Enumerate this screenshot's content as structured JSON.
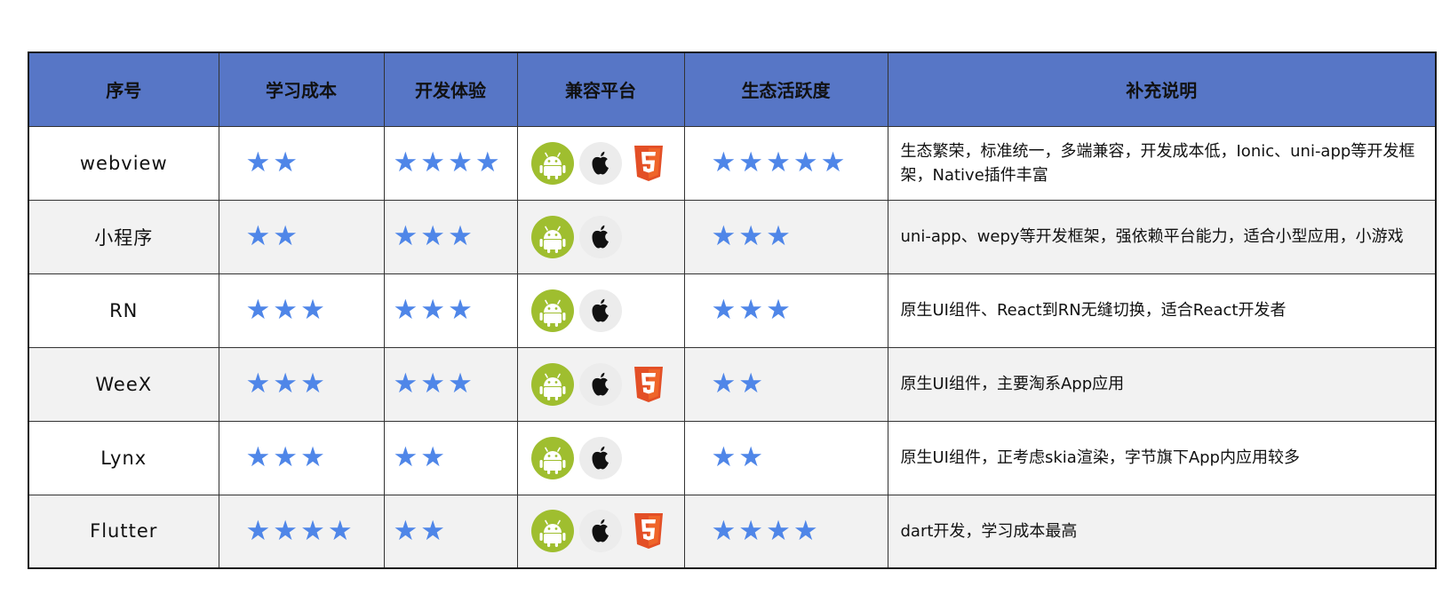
{
  "headers": [
    "序号",
    "学习成本",
    "开发体验",
    "兼容平台",
    "生态活跃度",
    "补充说明"
  ],
  "star_glyph": "★",
  "colors": {
    "header_bg": "#5776c6",
    "star": "#4f86e8",
    "android": "#9fbe2f",
    "html5": "#e34f26"
  },
  "rows": [
    {
      "name": "webview",
      "learning_cost": 2,
      "dev_experience": 4,
      "platforms": [
        "android-icon",
        "apple-icon",
        "html5-icon"
      ],
      "ecosystem": 5,
      "note": "生态繁荣，标准统一，多端兼容，开发成本低，Ionic、uni-app等开发框架，Native插件丰富"
    },
    {
      "name": "小程序",
      "learning_cost": 2,
      "dev_experience": 3,
      "platforms": [
        "android-icon",
        "apple-icon"
      ],
      "ecosystem": 3,
      "note": "uni-app、wepy等开发框架，强依赖平台能力，适合小型应用，小游戏"
    },
    {
      "name": "RN",
      "learning_cost": 3,
      "dev_experience": 3,
      "platforms": [
        "android-icon",
        "apple-icon"
      ],
      "ecosystem": 3,
      "note": "原生UI组件、React到RN无缝切换，适合React开发者"
    },
    {
      "name": "WeeX",
      "learning_cost": 3,
      "dev_experience": 3,
      "platforms": [
        "android-icon",
        "apple-icon",
        "html5-icon"
      ],
      "ecosystem": 2,
      "note": "原生UI组件，主要淘系App应用"
    },
    {
      "name": "Lynx",
      "learning_cost": 3,
      "dev_experience": 2,
      "platforms": [
        "android-icon",
        "apple-icon"
      ],
      "ecosystem": 2,
      "note": "原生UI组件，正考虑skia渲染，字节旗下App内应用较多"
    },
    {
      "name": "Flutter",
      "learning_cost": 4,
      "dev_experience": 2,
      "platforms": [
        "android-icon",
        "apple-icon",
        "html5-icon"
      ],
      "ecosystem": 4,
      "note": "dart开发，学习成本最高"
    }
  ]
}
